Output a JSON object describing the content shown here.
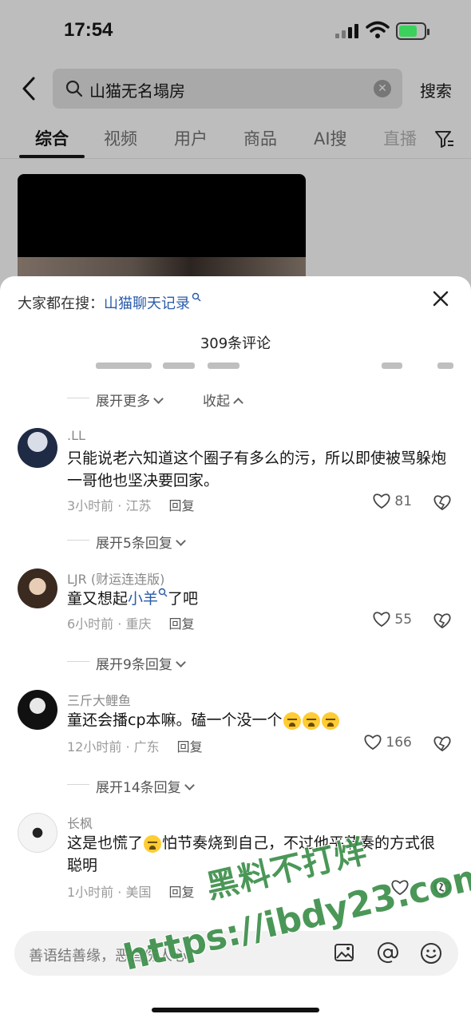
{
  "status": {
    "time": "17:54"
  },
  "search": {
    "query": "山猫无名塌房",
    "button": "搜索"
  },
  "tabs": [
    "综合",
    "视频",
    "用户",
    "商品",
    "AI搜",
    "直播"
  ],
  "sheet": {
    "hot_prefix": "大家都在搜：",
    "hot_link": "山猫聊天记录",
    "count": "309条评论",
    "expand_more": "展开更多",
    "collapse": "收起"
  },
  "comments": [
    {
      "user": ".LL",
      "text": "只能说老六知道这个圈子有多么的污，所以即使被骂躲炮一哥他也坚决要回家。",
      "meta": "3小时前 · 江苏",
      "reply": "回复",
      "likes": "81",
      "expand": "展开5条回复"
    },
    {
      "user": "LJR (财运连连版)",
      "text_pre": "童又想起",
      "text_link": "小羊",
      "text_post": "了吧",
      "meta": "6小时前 · 重庆",
      "reply": "回复",
      "likes": "55",
      "expand": "展开9条回复"
    },
    {
      "user": "三斤大鲤鱼",
      "text": "童还会播cp本嘛。磕一个没一个",
      "meta": "12小时前 · 广东",
      "reply": "回复",
      "likes": "166",
      "expand": "展开14条回复"
    },
    {
      "user": "长枫",
      "text_pre": "这是也慌了",
      "text_post": "怕节奏烧到自己，不过他平节奏的方式很聪明",
      "meta": "1小时前 · 美国",
      "reply": "回复",
      "likes": ""
    }
  ],
  "input": {
    "placeholder": "善语结善缘，恶言伤人心"
  },
  "watermark": {
    "line1": "黑料不打烊",
    "line2": "https://ibdy23.com"
  },
  "colors": {
    "link": "#2a5caa",
    "watermark": "#3c8f4a"
  }
}
